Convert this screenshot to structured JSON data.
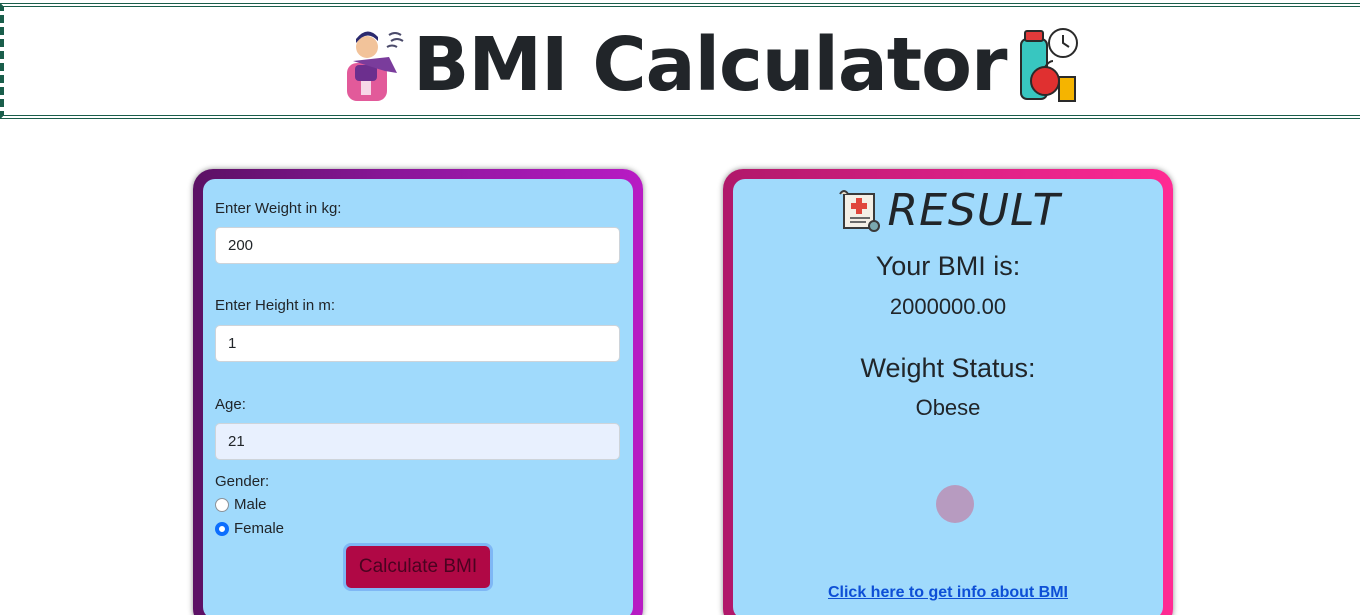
{
  "header": {
    "title": "BMI Calculator",
    "left_icon": "person-wind-icon",
    "right_icon": "fitness-bottle-apple-clock-icon"
  },
  "form": {
    "weight_label": "Enter Weight in kg:",
    "weight_value": "200",
    "height_label": "Enter Height in m:",
    "height_value": "1",
    "age_label": "Age:",
    "age_value": "21",
    "gender_label": "Gender:",
    "gender_options": [
      {
        "label": "Male",
        "checked": false
      },
      {
        "label": "Female",
        "checked": true
      }
    ],
    "calculate_label": "Calculate BMI"
  },
  "result": {
    "title": "RESULT",
    "title_icon": "medical-report-icon",
    "bmi_label": "Your BMI is:",
    "bmi_value": "2000000.00",
    "status_label": "Weight Status:",
    "status_value": "Obese",
    "info_link": "Click here to get info about BMI"
  },
  "colors": {
    "panel_bg": "#a0dafc",
    "left_border": "#8a1699",
    "right_border": "#d41f82",
    "button_bg": "#b00845",
    "link": "#0d4fd6",
    "header_border": "#1a5e4b"
  }
}
